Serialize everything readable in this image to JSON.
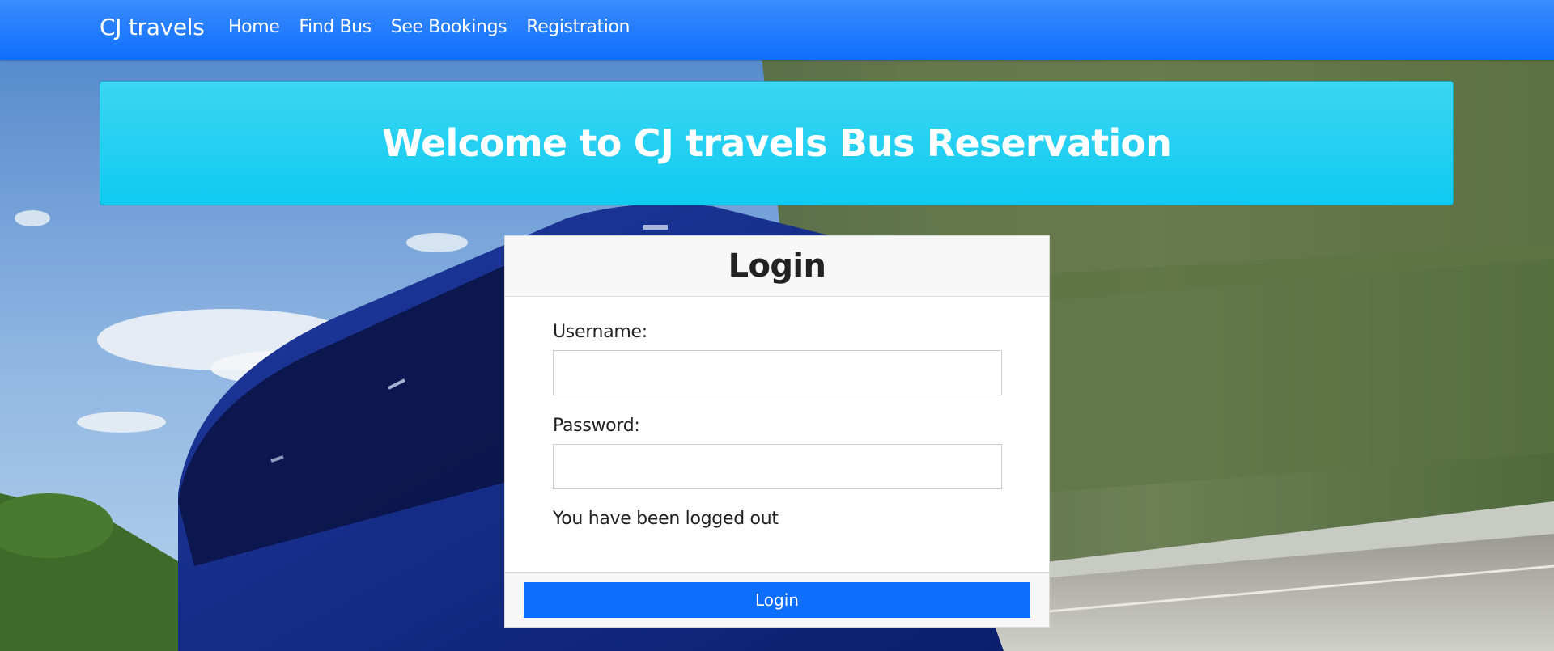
{
  "navbar": {
    "brand": "CJ travels",
    "links": [
      "Home",
      "Find Bus",
      "See Bookings",
      "Registration"
    ]
  },
  "jumbotron": {
    "heading": "Welcome to CJ travels Bus Reservation"
  },
  "login_card": {
    "title": "Login",
    "username_label": "Username:",
    "username_value": "",
    "password_label": "Password:",
    "password_value": "",
    "status_message": "You have been logged out",
    "submit_label": "Login"
  },
  "colors": {
    "navbar": "#0d6efd",
    "jumbotron": "#0dcaf0",
    "button": "#0d6efd"
  }
}
